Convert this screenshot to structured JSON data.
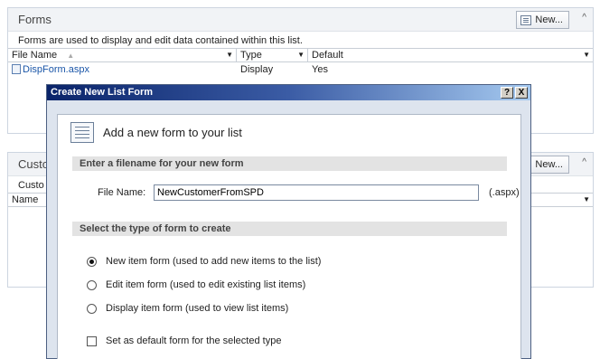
{
  "forms_panel": {
    "title": "Forms",
    "new_button": "New...",
    "collapse": "^",
    "description": "Forms are used to display and edit data contained within this list.",
    "columns": [
      "File Name",
      "Type",
      "Default"
    ],
    "rows": [
      {
        "file": "DispForm.aspx",
        "type": "Display",
        "default": "Yes"
      }
    ]
  },
  "custom_panel": {
    "title": "Custo",
    "new_button": "New...",
    "collapse": "^",
    "description": "Custo",
    "columns": [
      "Name"
    ]
  },
  "dialog": {
    "title": "Create New List Form",
    "help_button": "?",
    "close_button": "X",
    "header_text": "Add a new form to your list",
    "section_filename": "Enter a filename for your new form",
    "file_name_label": "File Name:",
    "file_name_value": "NewCustomerFromSPD",
    "file_name_suffix": "(.aspx)",
    "section_type": "Select the type of form to create",
    "options": [
      {
        "label": "New item form (used to add new items to the list)",
        "selected": true
      },
      {
        "label": "Edit item form (used to edit existing list items)",
        "selected": false
      },
      {
        "label": "Display item form (used to view list items)",
        "selected": false
      }
    ],
    "default_checkbox": "Set as default form for the selected type",
    "default_checked": false
  },
  "colors": {
    "title_gradient_start": "#0a246a",
    "title_gradient_end": "#a6caf0",
    "link": "#1a56a8"
  }
}
